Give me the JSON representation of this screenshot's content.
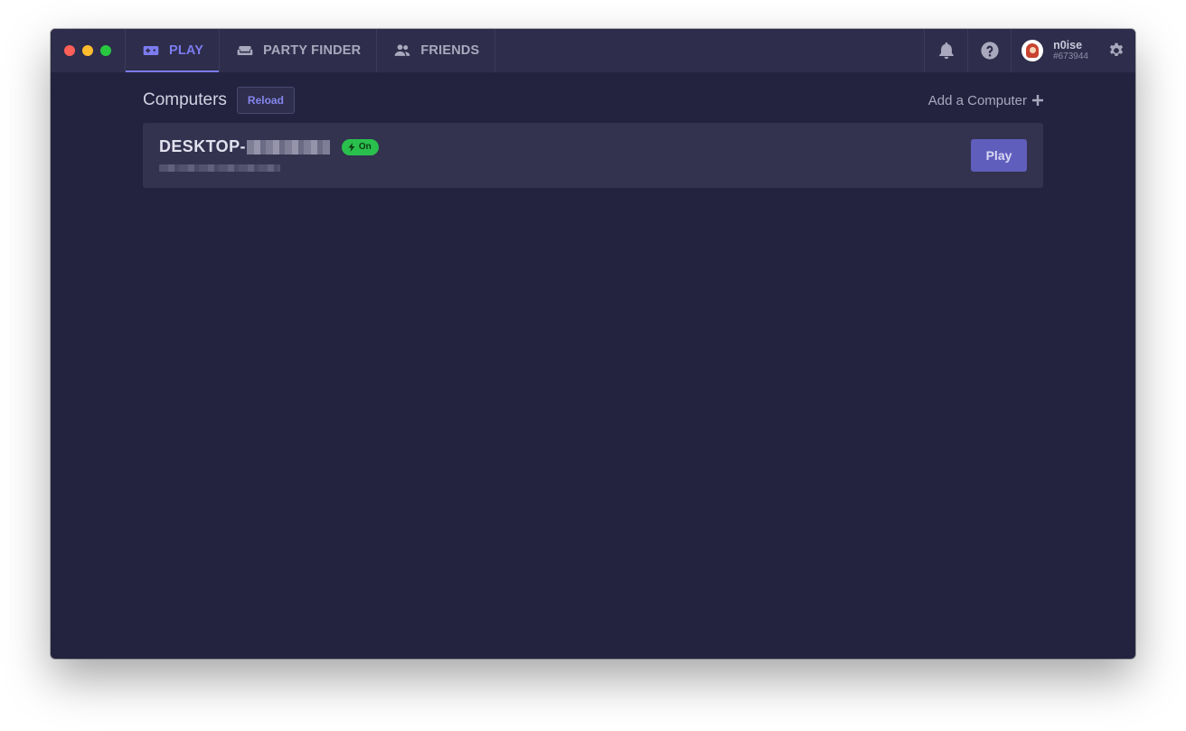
{
  "window": {
    "controls": [
      "close",
      "minimize",
      "maximize"
    ]
  },
  "nav": {
    "tabs": [
      {
        "label": "PLAY",
        "icon": "gamepad-icon",
        "active": true
      },
      {
        "label": "PARTY FINDER",
        "icon": "couch-icon",
        "active": false
      },
      {
        "label": "FRIENDS",
        "icon": "users-icon",
        "active": false
      }
    ]
  },
  "header_right": {
    "notifications_icon": "bell-icon",
    "help_icon": "question-icon",
    "user": {
      "name": "n0ise",
      "tag": "#673944"
    },
    "settings_icon": "gear-icon"
  },
  "computers": {
    "title": "Computers",
    "reload_label": "Reload",
    "add_label": "Add a Computer",
    "items": [
      {
        "name": "DESKTOP-",
        "status": "On",
        "play_label": "Play"
      }
    ]
  },
  "colors": {
    "accent": "#7c7cf0",
    "background": "#232340",
    "topbar": "#2e2d4b",
    "card": "#33324f",
    "status_on": "#2ac04d",
    "play_button": "#5f5ebc"
  }
}
